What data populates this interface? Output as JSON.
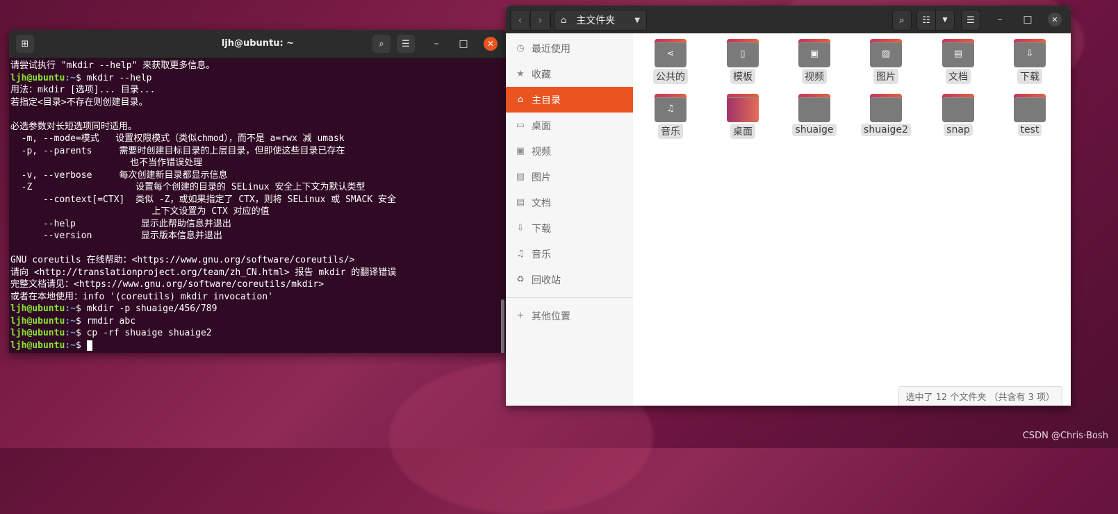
{
  "watermark": "CSDN @Chris·Bosh",
  "terminal": {
    "title": "ljh@ubuntu: ~",
    "lines": [
      "请尝试执行 \"mkdir --help\" 来获取更多信息。",
      "",
      "用法：mkdir [选项]... 目录...",
      "若指定<目录>不存在则创建目录。",
      "",
      "必选参数对长短选项同时适用。",
      "  -m, --mode=模式   设置权限模式（类似chmod），而不是 a=rwx 减 umask",
      "  -p, --parents     需要时创建目标目录的上层目录，但即使这些目录已存在",
      "                      也不当作错误处理",
      "  -v, --verbose     每次创建新目录都显示信息",
      "  -Z                   设置每个创建的目录的 SELinux 安全上下文为默认类型",
      "      --context[=CTX]  类似 -Z，或如果指定了 CTX，则将 SELinux 或 SMACK 安全",
      "                          上下文设置为 CTX 对应的值",
      "      --help            显示此帮助信息并退出",
      "      --version         显示版本信息并退出",
      "",
      "GNU coreutils 在线帮助：<https://www.gnu.org/software/coreutils/>",
      "请向 <http://translationproject.org/team/zh_CN.html> 报告 mkdir 的翻译错误",
      "完整文档请见：<https://www.gnu.org/software/coreutils/mkdir>",
      "或者在本地使用：info '(coreutils) mkdir invocation'",
      "",
      "",
      ""
    ],
    "prompt_user": "ljh@ubuntu",
    "prompt_path": ":~",
    "prompt_sym": "$",
    "commands": {
      "c1": " mkdir --help",
      "c2": " mkdir -p shuaige/456/789",
      "c3": " rmdir abc",
      "c4": " cp -rf shuaige shuaige2",
      "c5": " "
    }
  },
  "files": {
    "path_label": "主文件夹",
    "sidebar": {
      "recent": "最近使用",
      "starred": "收藏",
      "home": "主目录",
      "desktop": "桌面",
      "videos": "视频",
      "pictures": "图片",
      "documents": "文档",
      "downloads": "下载",
      "music": "音乐",
      "trash": "回收站",
      "other": "其他位置"
    },
    "folders": [
      "公共的",
      "模板",
      "视频",
      "图片",
      "文档",
      "下载",
      "音乐",
      "桌面",
      "shuaige",
      "shuaige2",
      "snap",
      "test"
    ],
    "status": "选中了 12 个文件夹 （共含有 3 项）"
  },
  "colors": {
    "accent": "#e95420",
    "terminal_bg": "#300a24",
    "prompt_user": "#8ae234",
    "prompt_path": "#729fcf"
  }
}
